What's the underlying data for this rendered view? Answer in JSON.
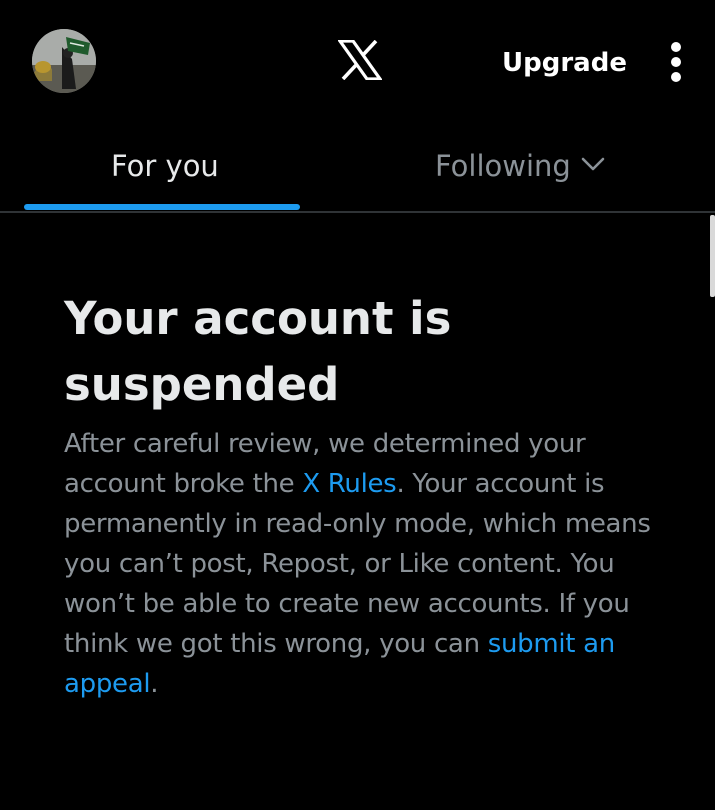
{
  "header": {
    "avatar_icon": "profile-avatar",
    "logo_icon": "x-logo-icon",
    "upgrade_label": "Upgrade",
    "more_icon": "vertical-ellipsis-icon"
  },
  "tabs": {
    "items": [
      {
        "label": "For you",
        "selected": true
      },
      {
        "label": "Following",
        "selected": false
      }
    ],
    "following_icon": "chevron-down-icon",
    "accent_color": "#1d9bf0"
  },
  "notice": {
    "title_line1": "Your account is",
    "title_line2": "suspended",
    "text_1": "After careful review, we determined your account broke the ",
    "rules_link": "X Rules",
    "text_2": ". Your account is permanently in read-only mode, which means you can’t post, Repost, or Like content. You won’t be able to create new accounts. If you think we got this wrong, you can ",
    "appeal_link": "submit an appeal",
    "text_3": "."
  },
  "colors": {
    "background": "#000000",
    "primary_text": "#e7e9ea",
    "secondary_text": "#8b9298",
    "link": "#1d9bf0",
    "divider": "#2f3336"
  }
}
